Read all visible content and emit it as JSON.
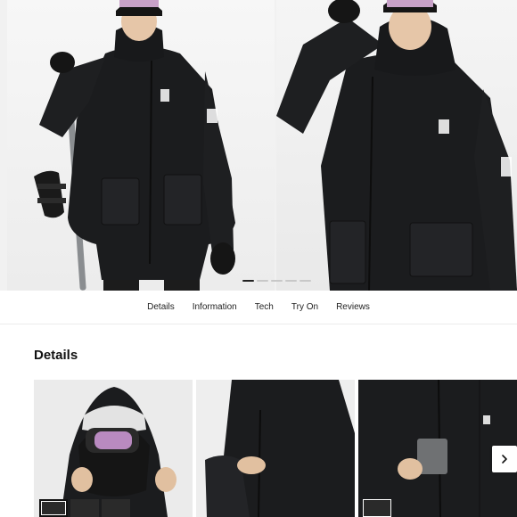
{
  "gallery": {
    "images": [
      {
        "alt_icon": "model-front-snowboard-image"
      },
      {
        "alt_icon": "model-side-salute-image"
      }
    ],
    "dots_total": 5,
    "dots_active": 1
  },
  "tabs": [
    {
      "label": "Details"
    },
    {
      "label": "Information"
    },
    {
      "label": "Tech"
    },
    {
      "label": "Try On"
    },
    {
      "label": "Reviews"
    }
  ],
  "details": {
    "title": "Details",
    "cards": [
      {
        "icon": "hood-goggles-image"
      },
      {
        "icon": "pit-zip-image"
      },
      {
        "icon": "chest-pocket-image"
      }
    ],
    "next_icon": "chevron-right-icon"
  },
  "colors": {
    "jacket": "#1b1c1e",
    "background": "#ffffff",
    "goggle_lens": "#b98ac0"
  }
}
